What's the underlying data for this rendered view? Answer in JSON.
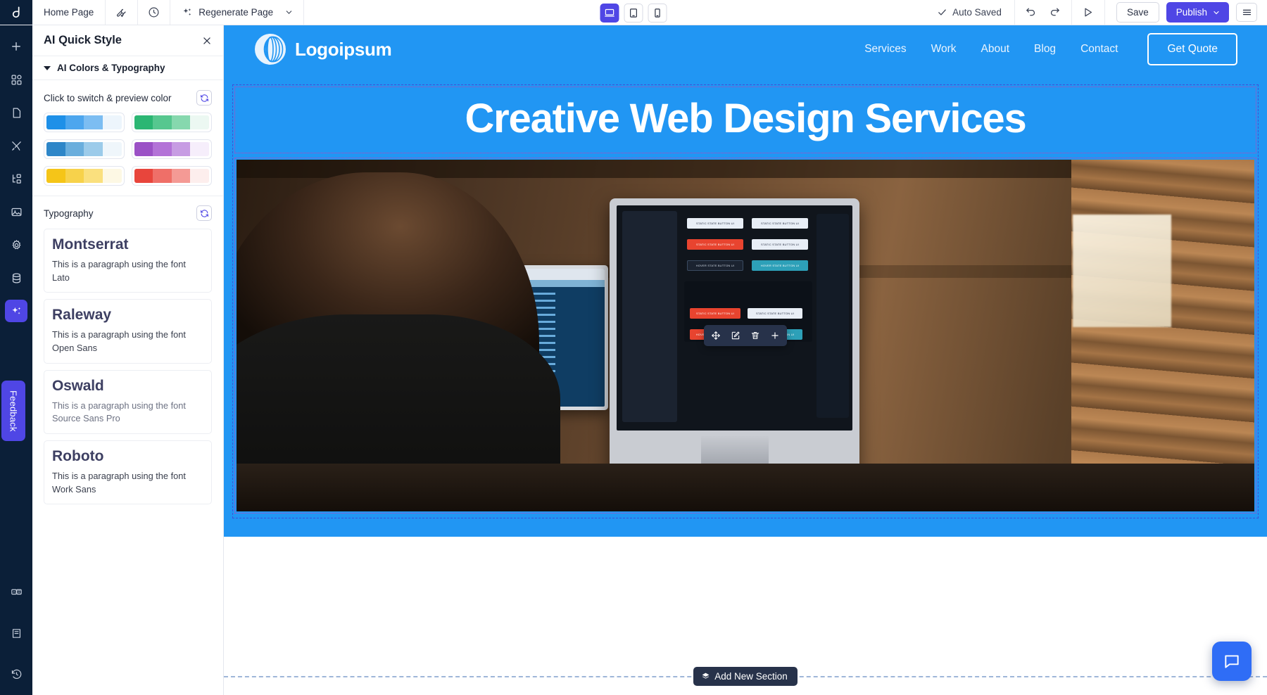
{
  "topbar": {
    "brand_icon": "app-logo-icon",
    "page_name": "Home Page",
    "wrench_icon": "wrench-icon",
    "history_icon": "clock-history-icon",
    "regenerate_label": "Regenerate Page",
    "regenerate_icon": "sparkles-icon",
    "regenerate_caret_icon": "chevron-down-icon",
    "autosaved_label": "Auto Saved",
    "autosaved_check_icon": "check-icon",
    "undo_icon": "undo-icon",
    "redo_icon": "redo-icon",
    "preview_icon": "play-preview-icon",
    "save_label": "Save",
    "publish_label": "Publish",
    "publish_caret_icon": "chevron-down-icon",
    "menu_icon": "hamburger-menu-icon",
    "viewports": [
      {
        "name": "desktop",
        "icon": "desktop-icon",
        "active": true
      },
      {
        "name": "tablet",
        "icon": "tablet-icon",
        "active": false
      },
      {
        "name": "mobile",
        "icon": "mobile-icon",
        "active": false
      }
    ]
  },
  "rail": {
    "items": [
      {
        "name": "add",
        "icon": "plus-icon",
        "active": false
      },
      {
        "name": "templates",
        "icon": "grid-blocks-icon",
        "active": false
      },
      {
        "name": "pages",
        "icon": "page-icon",
        "active": false
      },
      {
        "name": "design",
        "icon": "brush-tools-icon",
        "active": false
      },
      {
        "name": "structure",
        "icon": "sitemap-icon",
        "active": false
      },
      {
        "name": "media",
        "icon": "image-icon",
        "active": false
      },
      {
        "name": "settings",
        "icon": "gear-icon",
        "active": false
      },
      {
        "name": "database",
        "icon": "database-icon",
        "active": false
      },
      {
        "name": "ai-quick-style",
        "icon": "sparkles-icon",
        "active": true
      }
    ],
    "bottom_items": [
      {
        "name": "translate",
        "icon": "translate-icon"
      },
      {
        "name": "docs",
        "icon": "book-icon"
      },
      {
        "name": "history",
        "icon": "time-revert-icon"
      }
    ],
    "feedback_label": "Feedback"
  },
  "panel": {
    "title": "AI Quick Style",
    "close_icon": "close-icon",
    "section_label": "AI Colors & Typography",
    "colors": {
      "label": "Click to switch & preview color",
      "refresh_icon": "refresh-icon",
      "palettes": [
        {
          "name": "blue",
          "colors": [
            "#1e90e8",
            "#4da6ee",
            "#7cbdf2",
            "#edf5fc"
          ]
        },
        {
          "name": "green",
          "colors": [
            "#2bb673",
            "#56c78f",
            "#86d8ae",
            "#ecf8f2"
          ]
        },
        {
          "name": "steel-blue",
          "colors": [
            "#2e86c8",
            "#6aaedd",
            "#9ccbea",
            "#eff6fb"
          ]
        },
        {
          "name": "purple",
          "colors": [
            "#9b51c6",
            "#b372d7",
            "#c79ce3",
            "#f6eefb"
          ]
        },
        {
          "name": "yellow",
          "colors": [
            "#f5c518",
            "#f7d24b",
            "#fae07e",
            "#fdf8e4"
          ]
        },
        {
          "name": "red",
          "colors": [
            "#e8453c",
            "#ef6f68",
            "#f49a95",
            "#fdeeed"
          ]
        }
      ]
    },
    "typography": {
      "label": "Typography",
      "refresh_icon": "refresh-icon",
      "options": [
        {
          "heading": "Montserrat",
          "paragraph": "This is a paragraph using the font Lato"
        },
        {
          "heading": "Raleway",
          "paragraph": "This is a paragraph using the font Open Sans"
        },
        {
          "heading": "Oswald",
          "paragraph": "This is a paragraph using the font Source Sans Pro"
        },
        {
          "heading": "Roboto",
          "paragraph": "This is a paragraph using the font Work Sans"
        }
      ]
    }
  },
  "canvas": {
    "site": {
      "logo_text": "Logoipsum",
      "logo_icon": "concentric-circles-logo-icon",
      "nav_links": [
        "Services",
        "Work",
        "About",
        "Blog",
        "Contact"
      ],
      "cta_label": "Get Quote",
      "hero_title": "Creative Web Design Services",
      "hero_image_alt": "man working at desk with two monitors showing code and website mockups",
      "accent_color": "#2196f3"
    },
    "element_toolbar": {
      "move_icon": "move-arrows-icon",
      "edit_icon": "edit-pencil-icon",
      "delete_icon": "trash-icon",
      "add_icon": "plus-icon"
    },
    "add_section_label": "Add New Section",
    "add_section_icon": "layers-icon",
    "chat_icon": "chat-bubble-icon"
  }
}
